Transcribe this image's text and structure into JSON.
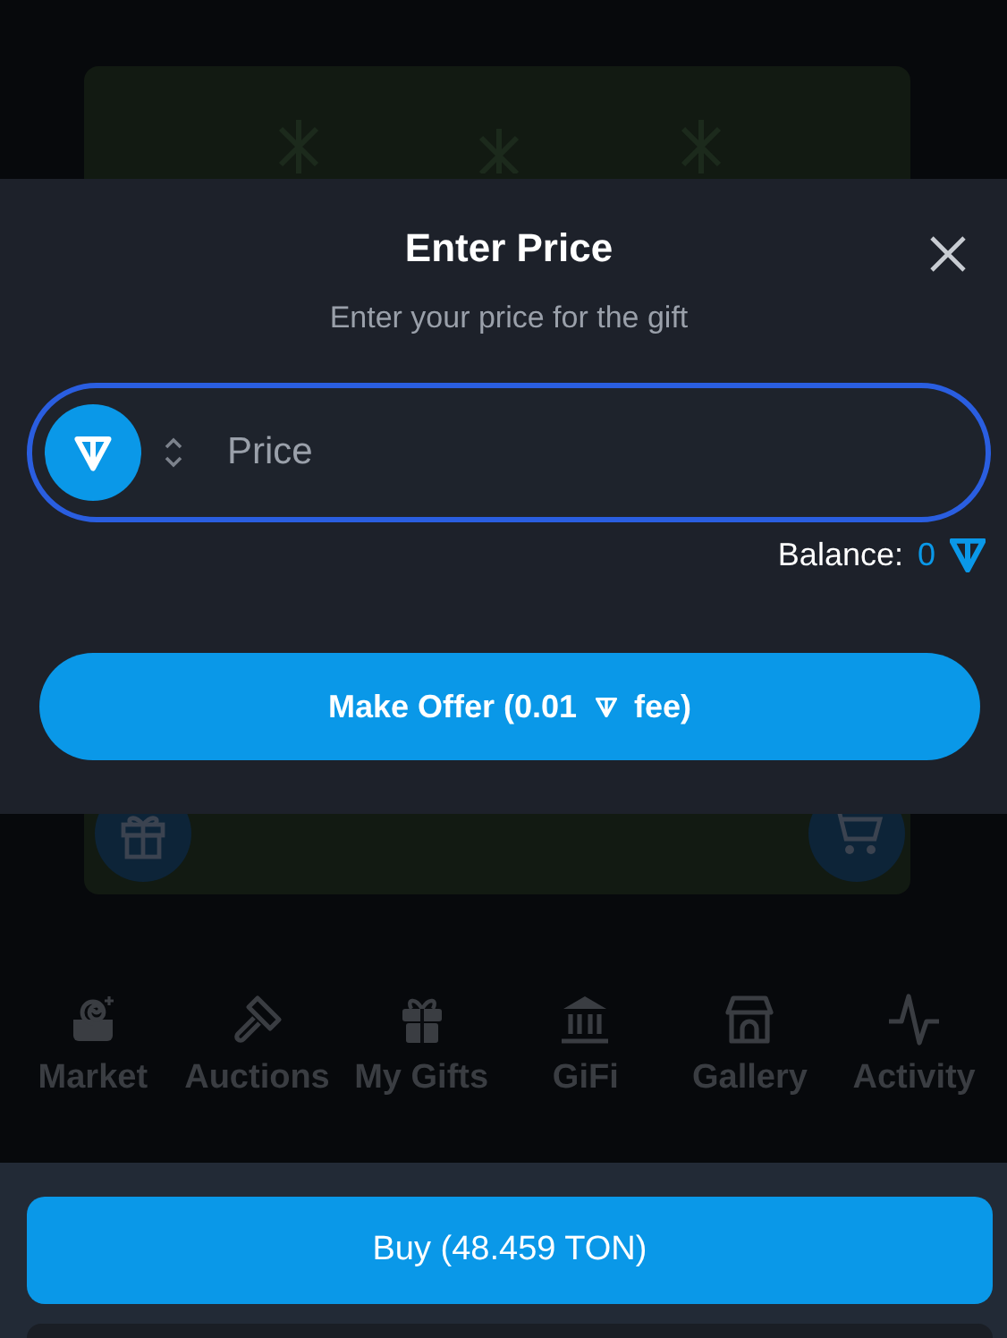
{
  "dialog": {
    "title": "Enter Price",
    "subtitle": "Enter your price for the gift",
    "price_field": {
      "placeholder": "Price"
    },
    "balance": {
      "label": "Balance:",
      "value": "0"
    },
    "offer_button": {
      "label_before": "Make Offer (0.01",
      "label_after": "fee)"
    }
  },
  "nav": [
    {
      "label": "Market"
    },
    {
      "label": "Auctions"
    },
    {
      "label": "My Gifts"
    },
    {
      "label": "GiFi"
    },
    {
      "label": "Gallery"
    },
    {
      "label": "Activity"
    }
  ],
  "buy_button": {
    "label": "Buy (48.459 TON)"
  }
}
